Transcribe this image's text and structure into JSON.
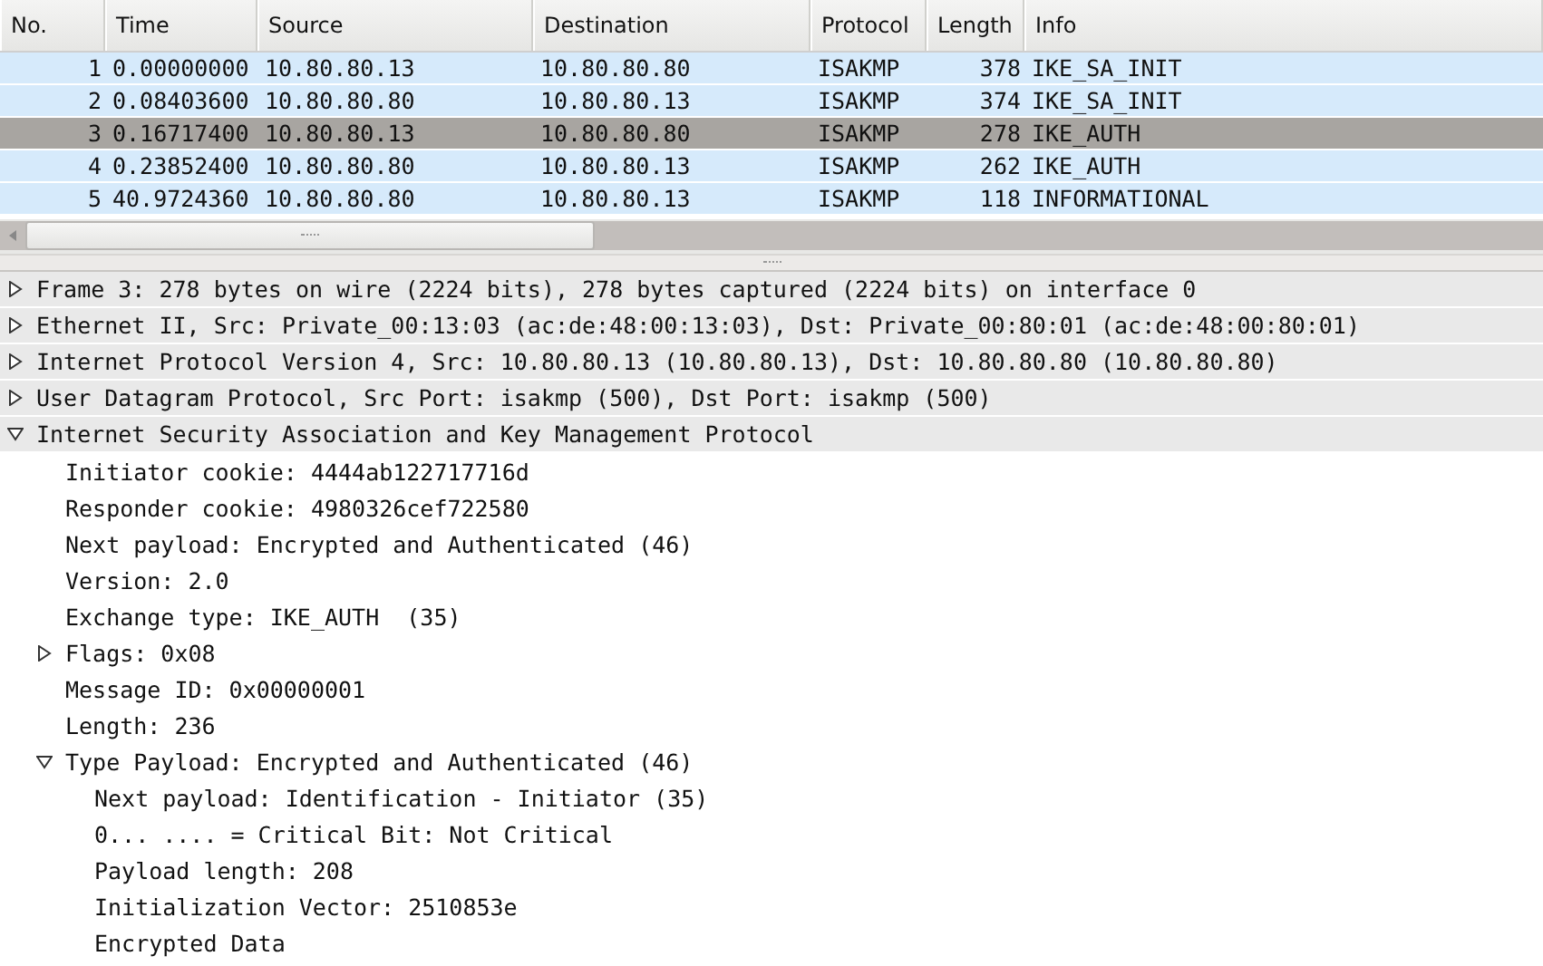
{
  "packet_list": {
    "columns": [
      "No.",
      "Time",
      "Source",
      "Destination",
      "Protocol",
      "Length",
      "Info"
    ],
    "rows": [
      {
        "cells": [
          "1",
          "0.00000000",
          "10.80.80.13",
          "10.80.80.80",
          "ISAKMP",
          "378",
          "IKE_SA_INIT"
        ],
        "selected": false
      },
      {
        "cells": [
          "2",
          "0.08403600",
          "10.80.80.80",
          "10.80.80.13",
          "ISAKMP",
          "374",
          "IKE_SA_INIT"
        ],
        "selected": false
      },
      {
        "cells": [
          "3",
          "0.16717400",
          "10.80.80.13",
          "10.80.80.80",
          "ISAKMP",
          "278",
          "IKE_AUTH"
        ],
        "selected": true
      },
      {
        "cells": [
          "4",
          "0.23852400",
          "10.80.80.80",
          "10.80.80.13",
          "ISAKMP",
          "262",
          "IKE_AUTH"
        ],
        "selected": false
      },
      {
        "cells": [
          "5",
          "40.9724360",
          "10.80.80.80",
          "10.80.80.13",
          "ISAKMP",
          "118",
          "INFORMATIONAL"
        ],
        "selected": false
      }
    ]
  },
  "details_tree": [
    {
      "label": "Frame 3: 278 bytes on wire (2224 bits), 278 bytes captured (2224 bits) on interface 0",
      "expanded": false
    },
    {
      "label": "Ethernet II, Src: Private_00:13:03 (ac:de:48:00:13:03), Dst: Private_00:80:01 (ac:de:48:00:80:01)",
      "expanded": false
    },
    {
      "label": "Internet Protocol Version 4, Src: 10.80.80.13 (10.80.80.13), Dst: 10.80.80.80 (10.80.80.80)",
      "expanded": false
    },
    {
      "label": "User Datagram Protocol, Src Port: isakmp (500), Dst Port: isakmp (500)",
      "expanded": false
    },
    {
      "label": "Internet Security Association and Key Management Protocol",
      "expanded": true,
      "children": [
        {
          "label": "Initiator cookie: 4444ab122717716d"
        },
        {
          "label": "Responder cookie: 4980326cef722580"
        },
        {
          "label": "Next payload: Encrypted and Authenticated (46)"
        },
        {
          "label": "Version: 2.0"
        },
        {
          "label": "Exchange type: IKE_AUTH  (35)"
        },
        {
          "label": "Flags: 0x08",
          "expanded": false
        },
        {
          "label": "Message ID: 0x00000001"
        },
        {
          "label": "Length: 236"
        },
        {
          "label": "Type Payload: Encrypted and Authenticated (46)",
          "expanded": true,
          "children": [
            {
              "label": "Next payload: Identification - Initiator (35)"
            },
            {
              "label": "0... .... = Critical Bit: Not Critical"
            },
            {
              "label": "Payload length: 208"
            },
            {
              "label": "Initialization Vector: 2510853e"
            },
            {
              "label": "Encrypted Data"
            }
          ]
        }
      ]
    }
  ]
}
